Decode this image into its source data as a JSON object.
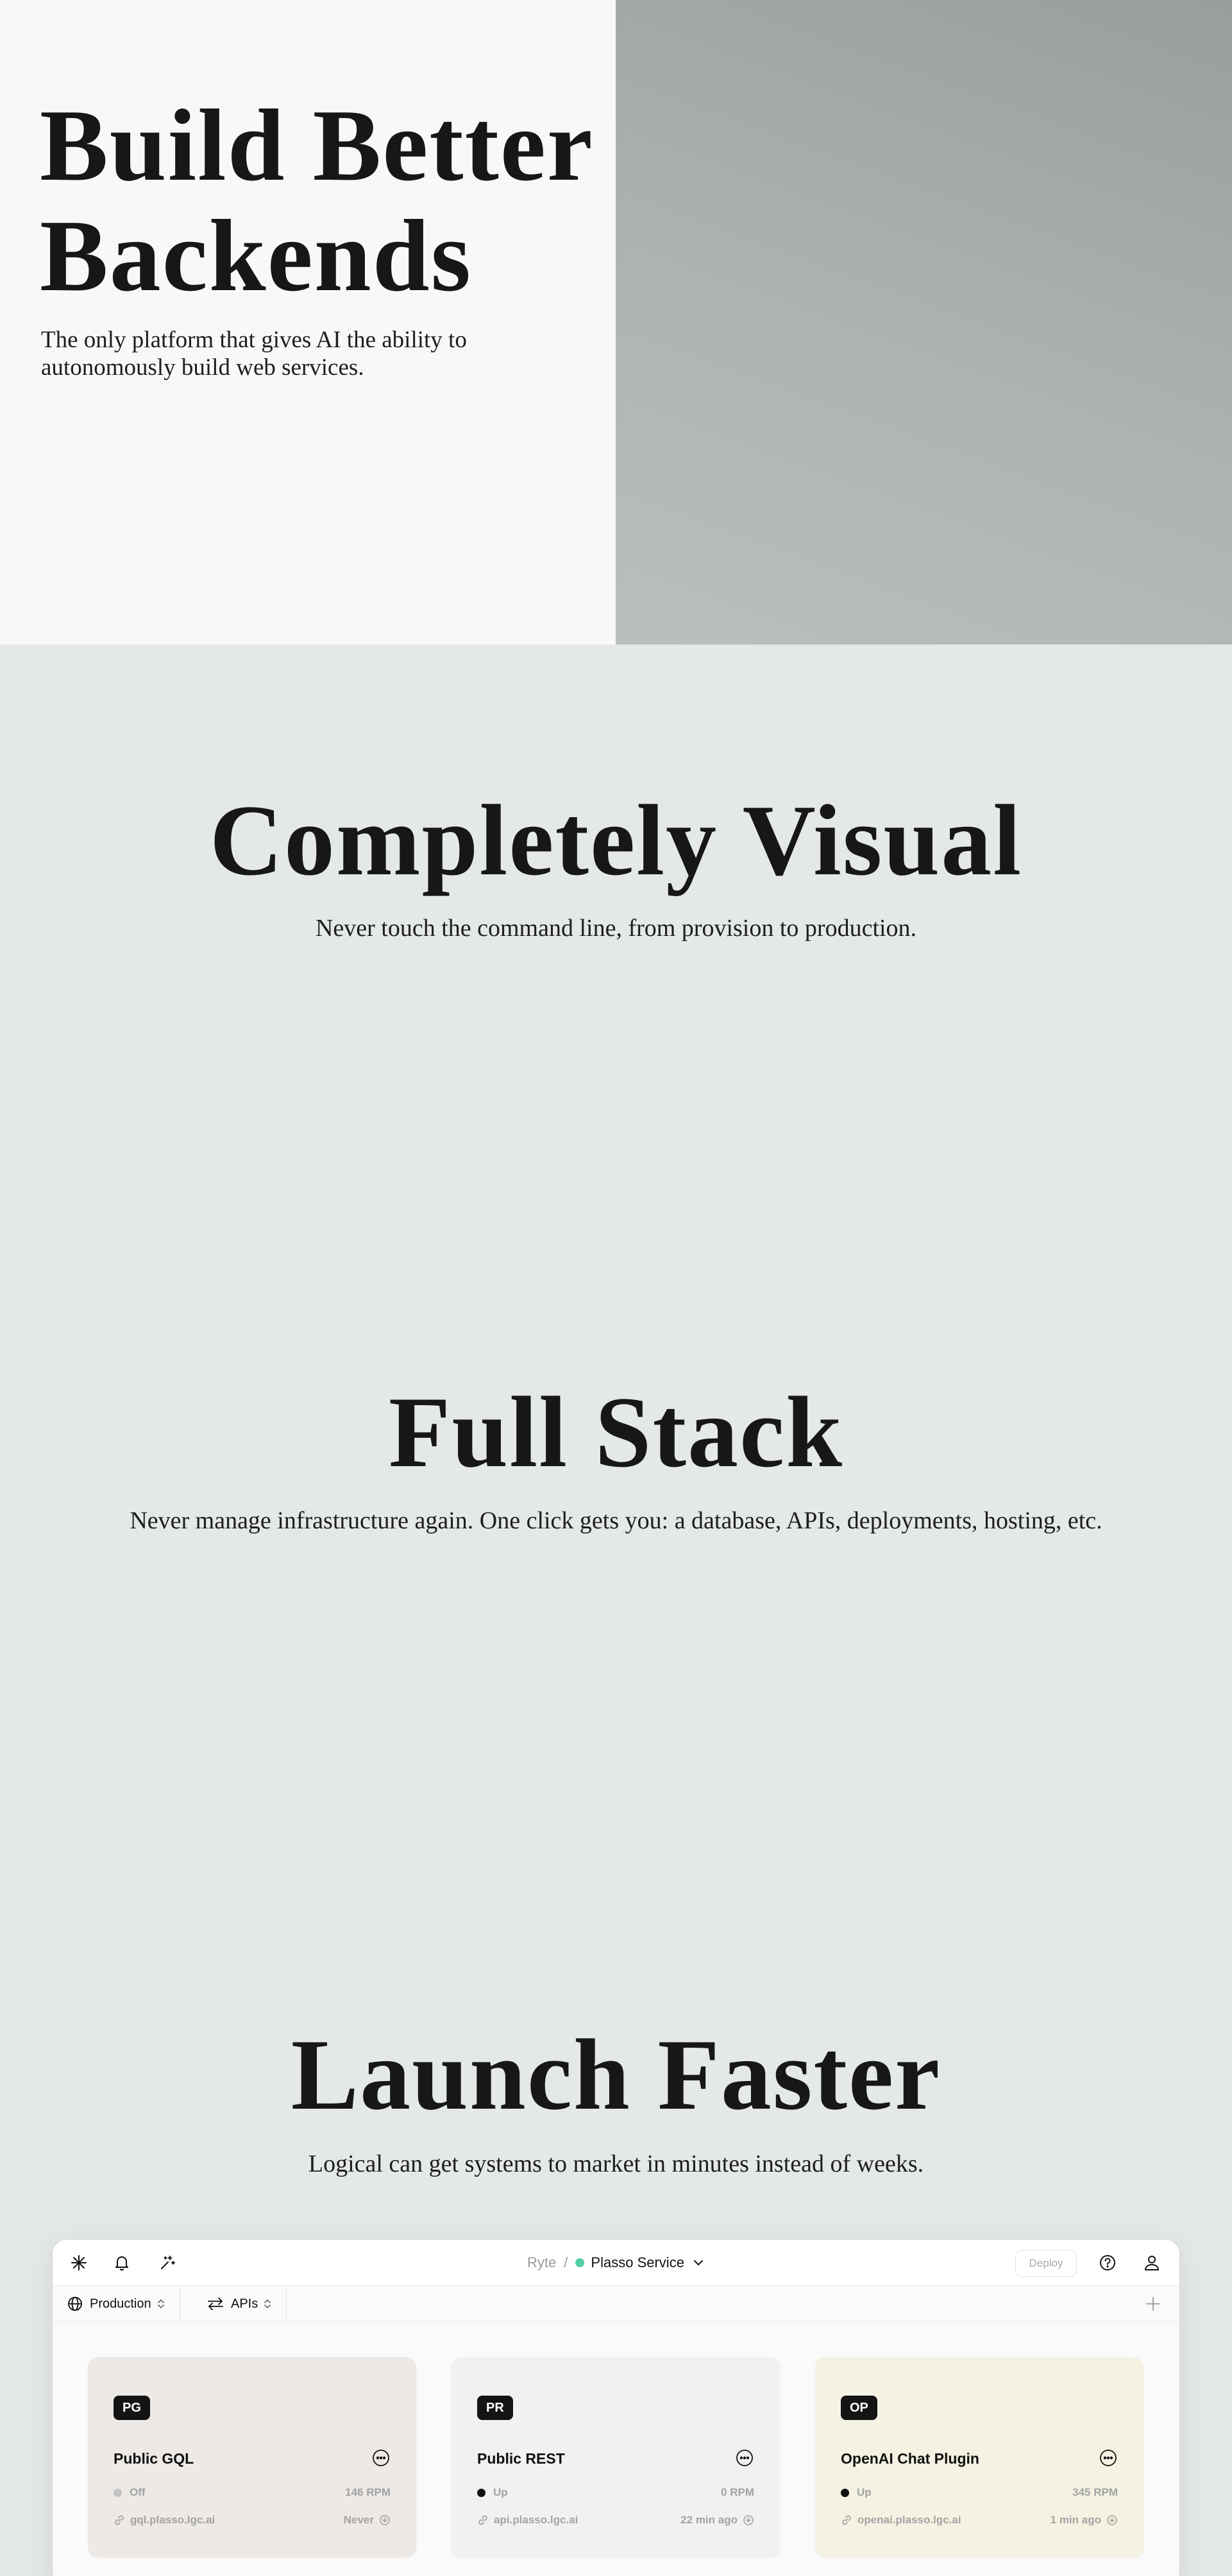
{
  "hero": {
    "title_line1": "Build Better",
    "title_line2": "Backends",
    "subtitle_line1": "The only platform that gives AI the ability to",
    "subtitle_line2": "autonomously build web services."
  },
  "sections": [
    {
      "title": "Completely Visual",
      "subtitle": "Never touch the command line, from provision to production."
    },
    {
      "title": "Full Stack",
      "subtitle": "Never manage infrastructure again. One click gets you: a database, APIs, deployments, hosting, etc."
    },
    {
      "title": "Launch Faster",
      "subtitle": "Logical can get systems to market in minutes instead of weeks."
    }
  ],
  "app": {
    "topbar": {
      "icons": [
        "logo-icon",
        "bell-icon",
        "sparkle-icon"
      ],
      "org": "Ryte",
      "separator": "/",
      "service": "Plasso Service",
      "service_status_color": "#54d1a5",
      "deploy_label": "Deploy",
      "right_icons": [
        "help-icon",
        "user-icon"
      ]
    },
    "toolbar": {
      "environment": "Production",
      "view": "APIs"
    },
    "cards": [
      {
        "badge": "PG",
        "name": "Public GQL",
        "status": "Off",
        "status_color": "#c4c4c4",
        "rpm": "146 RPM",
        "url": "gql.plasso.lgc.ai",
        "time": "Never",
        "bg": "#ece9e6"
      },
      {
        "badge": "PR",
        "name": "Public REST",
        "status": "Up",
        "status_color": "#111111",
        "rpm": "0 RPM",
        "url": "api.plasso.lgc.ai",
        "time": "22 min ago",
        "bg": "#f1f1f0"
      },
      {
        "badge": "OP",
        "name": "OpenAI Chat Plugin",
        "status": "Up",
        "status_color": "#111111",
        "rpm": "345 RPM",
        "url": "openai.plasso.lgc.ai",
        "time": "1 min ago",
        "bg": "#f4f2e2"
      }
    ]
  }
}
